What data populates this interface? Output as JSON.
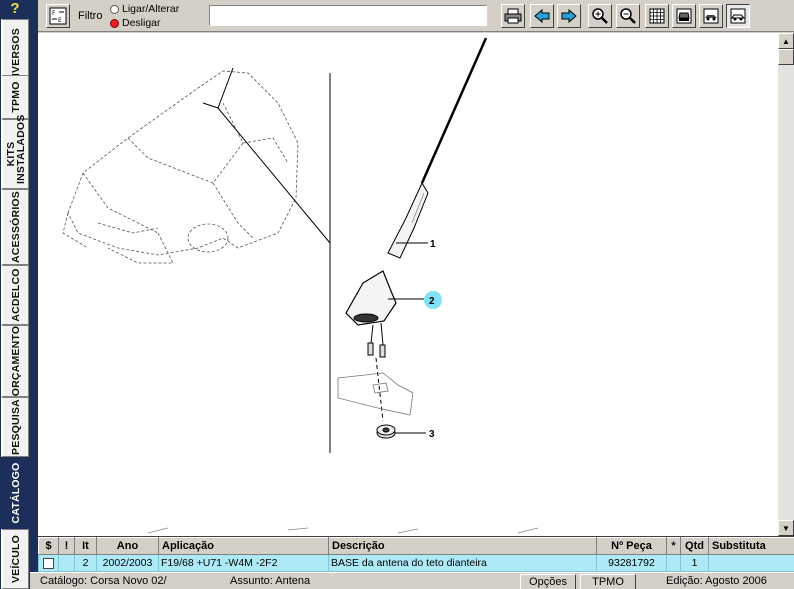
{
  "sidebar": {
    "help_label": "?",
    "tabs": [
      {
        "label": "DIVERSOS",
        "active": false
      },
      {
        "label": "TPMO",
        "active": false
      },
      {
        "label": "KITS INSTALADOS",
        "active": false
      },
      {
        "label": "ACESSÓRIOS",
        "active": false
      },
      {
        "label": "ACDELCO",
        "active": false
      },
      {
        "label": "ORÇAMENTO",
        "active": false
      },
      {
        "label": "PESQUISA",
        "active": false
      },
      {
        "label": "CATÁLOGO",
        "active": true
      },
      {
        "label": "VEÍCULO",
        "active": false
      }
    ]
  },
  "toolbar": {
    "filter_label": "Filtro",
    "radio_on_label": "Ligar/Alterar",
    "radio_off_label": "Desligar",
    "filter_value": "",
    "icons": [
      "filter-toggle-icon",
      "print-icon",
      "arrow-left-icon",
      "arrow-right-icon",
      "zoom-in-icon",
      "zoom-out-icon",
      "grid-view-icon",
      "car-front-icon",
      "car-side-icon",
      "car-selected-icon"
    ]
  },
  "diagram": {
    "callouts": [
      "1",
      "2",
      "3"
    ],
    "highlighted_callout": "2",
    "highlight_color": "#7fe3f5"
  },
  "grid": {
    "headers": [
      "$",
      "!",
      "It",
      "Ano",
      "Aplicação",
      "Descrição",
      "Nº Peça",
      "*",
      "Qtd",
      "Substituta"
    ],
    "rows": [
      {
        "checked": false,
        "alert": "",
        "item": "2",
        "ano": "2002/2003",
        "aplicacao": "F19/68 +U71 -W4M -2F2",
        "descricao": "BASE da antena do teto dianteira",
        "peca": "93281792",
        "star": "",
        "qtd": "1",
        "substituta": ""
      }
    ],
    "row_color": "#aee9f7"
  },
  "status": {
    "catalogo": "Catálogo: Corsa Novo 02/",
    "assunto": "Assunto: Antena",
    "opcoes": "Opções",
    "tpmo": "TPMO",
    "edicao": "Edição: Agosto 2006"
  },
  "colors": {
    "sidebar": "#1c2f5a",
    "help": "#f0e050"
  }
}
